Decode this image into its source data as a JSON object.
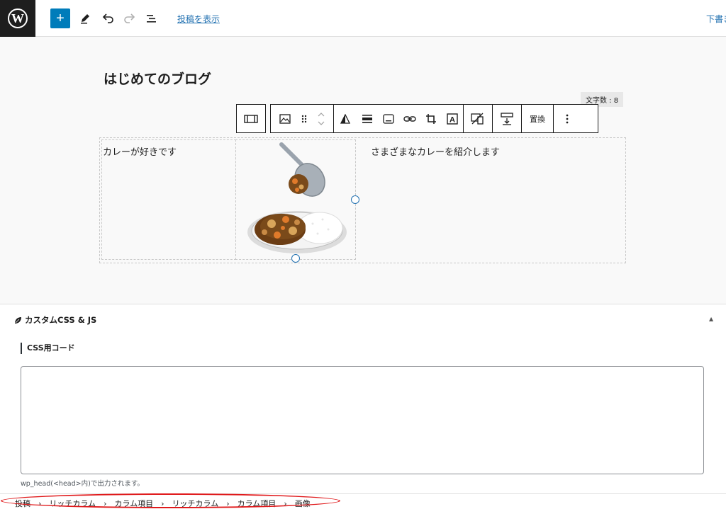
{
  "topbar": {
    "add_label": "+",
    "view_post_label": "投稿を表示",
    "draft_label": "下書き"
  },
  "editor": {
    "post_title": "はじめてのブログ",
    "char_count": "文字数 : 8"
  },
  "block_toolbar": {
    "replace_label": "置換"
  },
  "rich_columns": {
    "col1_text": "カレーが好きです",
    "col3_text": "さまざまなカレーを紹介します"
  },
  "meta_box": {
    "title": "カスタムCSS & JS",
    "css_label": "CSS用コード",
    "css_value": "",
    "hint": "wp_head(<head>内)で出力されます。"
  },
  "breadcrumb": {
    "items": [
      "投稿",
      "リッチカラム",
      "カラム項目",
      "リッチカラム",
      "カラム項目",
      "画像"
    ],
    "separator": "›"
  },
  "colors": {
    "accent": "#007cba",
    "link": "#2271b1",
    "highlight": "#e0191b"
  }
}
